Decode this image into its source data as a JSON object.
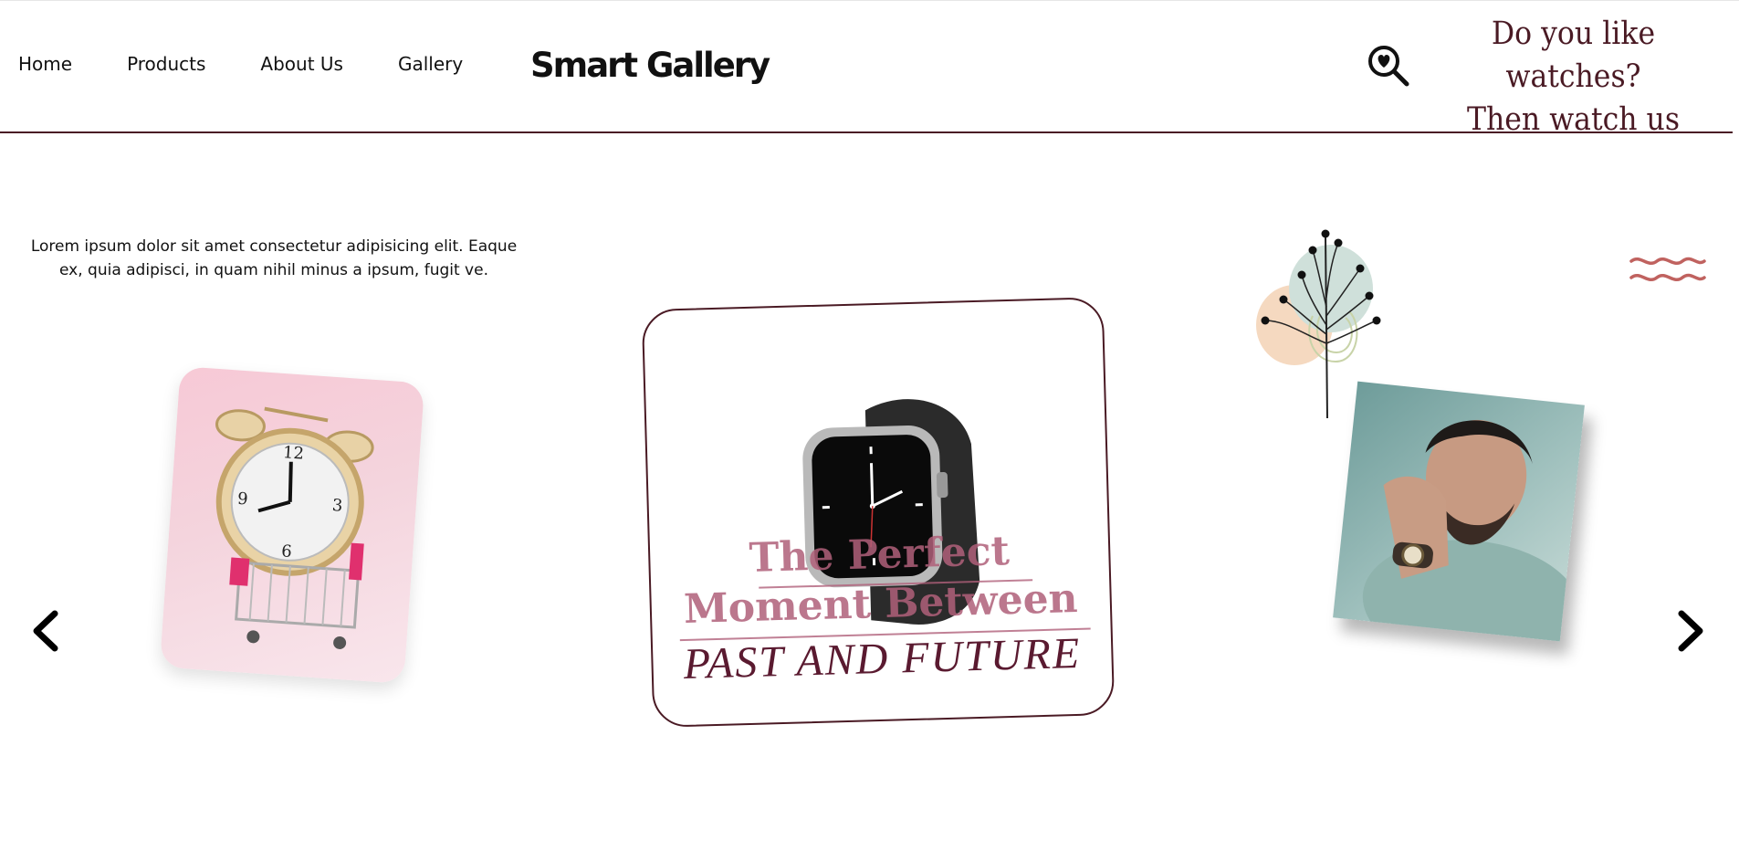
{
  "nav": {
    "items": [
      {
        "label": "Home"
      },
      {
        "label": "Products"
      },
      {
        "label": "About Us"
      },
      {
        "label": "Gallery"
      }
    ]
  },
  "header": {
    "logo": "Smart Gallery",
    "tagline_line1": "Do you like watches?",
    "tagline_line2": "Then watch us",
    "search_icon": "heart-magnifier-icon"
  },
  "hero": {
    "lead": "Lorem ipsum dolor sit amet consectetur adipisicing elit. Eaque ex, quia adipisci, in quam nihil minus a ipsum, fugit ve."
  },
  "slider": {
    "prev_icon": "chevron-left-icon",
    "next_icon": "chevron-right-icon",
    "center_title_line1": "The Perfect",
    "center_title_line2": "Moment Between",
    "center_title_line3": "PAST AND FUTURE"
  },
  "colors": {
    "accent": "#4a1a24",
    "pink": "#b0607a",
    "wave": "#c0625f"
  }
}
